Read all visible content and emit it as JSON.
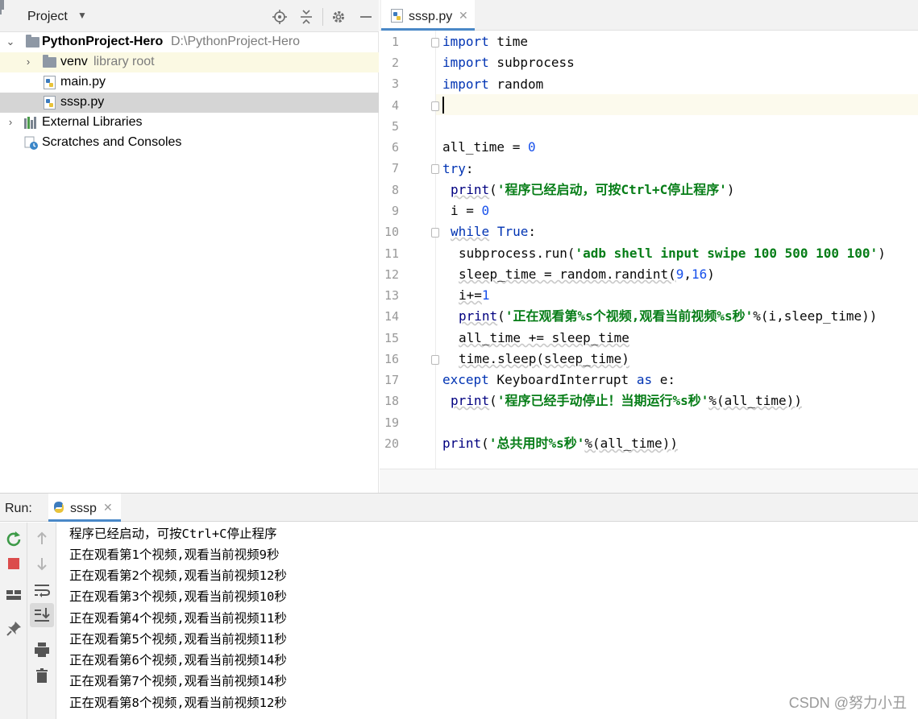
{
  "project": {
    "title": "Project",
    "root_name": "PythonProject-Hero",
    "root_path": "D:\\PythonProject-Hero",
    "venv_name": "venv",
    "venv_sub": "library root",
    "files": [
      "main.py",
      "sssp.py"
    ],
    "external": "External Libraries",
    "scratches": "Scratches and Consoles"
  },
  "editor": {
    "tab": "sssp.py",
    "line_numbers": [
      "1",
      "2",
      "3",
      "4",
      "5",
      "6",
      "7",
      "8",
      "9",
      "10",
      "11",
      "12",
      "13",
      "14",
      "15",
      "16",
      "17",
      "18",
      "19",
      "20"
    ]
  },
  "code": {
    "l1_kw": "import",
    "l1_rest": " time",
    "l2_kw": "import",
    "l2_rest": " subprocess",
    "l3_kw": "import",
    "l3_rest": " random",
    "l6_a": "all_time = ",
    "l6_num": "0",
    "l7_kw": "try",
    "l7_rest": ":",
    "l8_fn": "print",
    "l8_open": "(",
    "l8_str": "'程序已经启动，可按Ctrl+C停止程序'",
    "l8_close": ")",
    "l9_a": "i = ",
    "l9_num": "0",
    "l10_kw": "while",
    "l10_kw2": "True",
    "l10_rest": ":",
    "l11_a": "subprocess.run(",
    "l11_str": "'adb shell input swipe 100 500 100 100'",
    "l11_close": ")",
    "l12_a": "sleep_time = random.randint(",
    "l12_n1": "9",
    "l12_comma": ",",
    "l12_n2": "16",
    "l12_close": ")",
    "l13_a": "i+=",
    "l13_num": "1",
    "l14_fn": "print",
    "l14_open": "(",
    "l14_str": "'正在观看第%s个视频,观看当前视频%s秒'",
    "l14_rest": "%(i,sleep_time))",
    "l15_a": "all_time += sleep_time",
    "l16_a": "time.sleep(sleep_time)",
    "l17_kw": "except",
    "l17_mid": " KeyboardInterrupt ",
    "l17_kw2": "as",
    "l17_rest": " e:",
    "l18_fn": "print",
    "l18_open": "(",
    "l18_str": "'程序已经手动停止！当期运行%s秒'",
    "l18_rest": "%(all_time))",
    "l20_fn": "print",
    "l20_open": "(",
    "l20_str": "'总共用时%s秒'",
    "l20_rest": "%(all_time))"
  },
  "run": {
    "label": "Run:",
    "tab": "sssp",
    "output": [
      "程序已经启动，可按Ctrl+C停止程序",
      "正在观看第1个视频,观看当前视频9秒",
      "正在观看第2个视频,观看当前视频12秒",
      "正在观看第3个视频,观看当前视频10秒",
      "正在观看第4个视频,观看当前视频11秒",
      "正在观看第5个视频,观看当前视频11秒",
      "正在观看第6个视频,观看当前视频14秒",
      "正在观看第7个视频,观看当前视频14秒",
      "正在观看第8个视频,观看当前视频12秒"
    ]
  },
  "watermark": "CSDN @努力小丑",
  "colors": {
    "keyword": "#0033b3",
    "string": "#067d17",
    "number": "#1750eb",
    "accent": "#4a88c7"
  }
}
